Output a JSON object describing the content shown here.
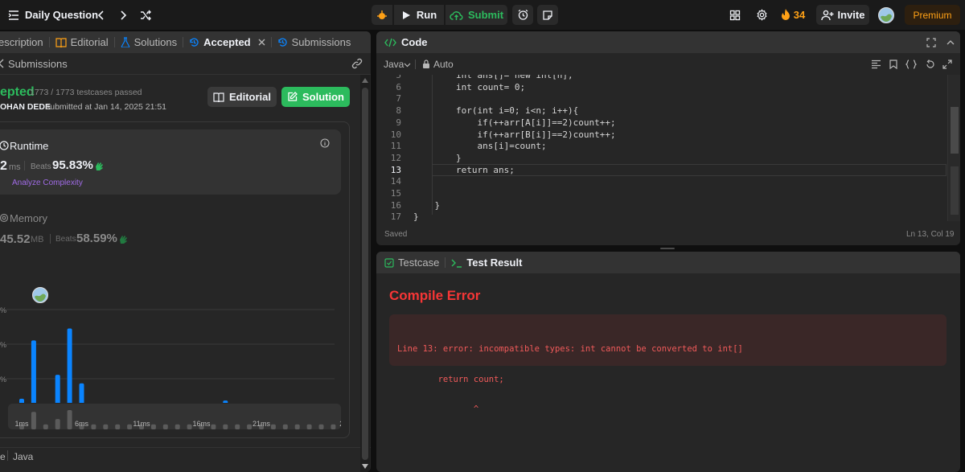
{
  "topbar": {
    "problem_list_label": "Daily Question",
    "run_label": "Run",
    "submit_label": "Submit",
    "streak_count": "34",
    "invite_label": "Invite",
    "premium_label": "Premium"
  },
  "left_tabs": [
    {
      "label": "escription"
    },
    {
      "label": "Editorial"
    },
    {
      "label": "Solutions"
    },
    {
      "label": "Accepted"
    },
    {
      "label": "Submissions"
    }
  ],
  "left_subheader": "Submissions",
  "submission": {
    "status": "epted",
    "testcases": "1773 / 1773 testcases passed",
    "user": "OHAN DEDE",
    "submitted_text": "submitted at Jan 14, 2025 21:51",
    "editorial_btn": "Editorial",
    "solution_btn": "Solution"
  },
  "runtime": {
    "label": "Runtime",
    "value": "2",
    "unit": "ms",
    "beats_label": "Beats",
    "beats_value": "95.83%",
    "analyze_label": "Analyze Complexity"
  },
  "memory": {
    "label": "Memory",
    "value": "45.52",
    "unit": "MB",
    "beats_label": "Beats",
    "beats_value": "58.59%"
  },
  "chart_data": {
    "type": "bar",
    "y_ticks": [
      "0%",
      "0%",
      "0%",
      "0%"
    ],
    "x_ticks": [
      "1ms",
      "6ms",
      "11ms",
      "16ms",
      "21ms",
      "29ms"
    ],
    "values": [
      4,
      21,
      1.3,
      11,
      24.5,
      8.5,
      1.3,
      1.3,
      1.1,
      1.1,
      1.1,
      1.3,
      1.1,
      1.1,
      1.1,
      1.1,
      1.3,
      3.5,
      1.3,
      1.1,
      2.5,
      1.3,
      1.1,
      1.1,
      1.1,
      1.1,
      1.1,
      1.1
    ],
    "ylim": [
      0,
      30
    ]
  },
  "mini_chart": {
    "x_ticks": [
      "1ms",
      "6ms",
      "11ms",
      "16ms",
      "21ms",
      "29ms"
    ],
    "values": [
      1,
      8,
      1,
      4,
      9,
      1,
      1,
      1,
      1,
      1,
      1,
      1,
      1,
      1,
      1,
      1,
      1,
      1,
      1,
      1,
      1,
      1,
      1,
      1,
      1,
      1,
      1,
      1
    ]
  },
  "bottom_lang": {
    "left": "e",
    "right": "Java"
  },
  "code_panel": {
    "title": "Code",
    "language": "Java",
    "mode": "Auto",
    "status": "Saved",
    "cursor": "Ln 13, Col 19",
    "lines": [
      {
        "num": "5",
        "text": "        int ans[]= new int[n];"
      },
      {
        "num": "6",
        "text": "        int count= 0;"
      },
      {
        "num": "7",
        "text": ""
      },
      {
        "num": "8",
        "text": "        for(int i=0; i<n; i++){"
      },
      {
        "num": "9",
        "text": "            if(++arr[A[i]]==2)count++;"
      },
      {
        "num": "10",
        "text": "            if(++arr[B[i]]==2)count++;"
      },
      {
        "num": "11",
        "text": "            ans[i]=count;"
      },
      {
        "num": "12",
        "text": "        }"
      },
      {
        "num": "13",
        "text": "        return ans;"
      },
      {
        "num": "14",
        "text": ""
      },
      {
        "num": "15",
        "text": ""
      },
      {
        "num": "16",
        "text": "    }"
      },
      {
        "num": "17",
        "text": "}"
      }
    ]
  },
  "result_panel": {
    "testcase_tab": "Testcase",
    "result_tab": "Test Result",
    "error_title": "Compile Error",
    "error_lines": [
      "Line 13: error: incompatible types: int cannot be converted to int[]",
      "        return count;",
      "               ^"
    ]
  },
  "colors": {
    "accent_green": "#2cbb5d",
    "accent_blue": "#0a84ff",
    "error_red": "#f63636",
    "premium_orange": "#ffa116"
  }
}
